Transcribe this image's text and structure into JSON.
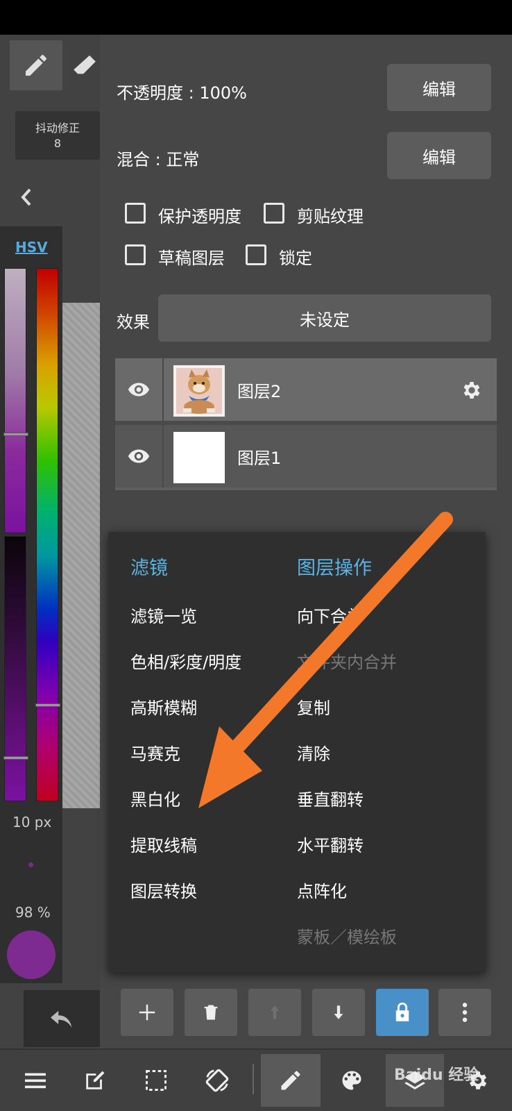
{
  "left_panel": {
    "stabilizer_label": "抖动修正",
    "stabilizer_value": "8",
    "color_mode": "HSV",
    "brush_size": "10 px",
    "brush_opacity": "98 %"
  },
  "layer_props": {
    "opacity_label": "不透明度 : 100%",
    "blend_label": "混合 : 正常",
    "edit_label": "编辑",
    "checkboxes": {
      "protect_alpha": "保护透明度",
      "clipping": "剪贴纹理",
      "draft": "草稿图层",
      "lock": "锁定"
    },
    "effect_label": "效果",
    "effect_value": "未设定"
  },
  "layers": [
    {
      "name": "图层2"
    },
    {
      "name": "图层1"
    }
  ],
  "menu": {
    "filter_header": "滤镜",
    "filters": [
      "滤镜一览",
      "色相/彩度/明度",
      "高斯模糊",
      "马赛克",
      "黑白化",
      "提取线稿",
      "图层转换"
    ],
    "ops_header": "图层操作",
    "ops": [
      "向下合并",
      "文件夹内合并",
      "复制",
      "清除",
      "垂直翻转",
      "水平翻转",
      "点阵化",
      "蒙板／模绘板"
    ]
  },
  "watermark": "Baidu 经验",
  "colors": {
    "accent_blue": "#5ab4e6",
    "arrow_orange": "#f4782a",
    "lock_blue": "#4a90c8",
    "brush_color": "#7d2a91"
  },
  "icons": {
    "pen": "pen-icon",
    "eraser": "eraser-icon",
    "eye": "eye-icon",
    "gear": "gear-icon",
    "undo": "undo-icon"
  }
}
